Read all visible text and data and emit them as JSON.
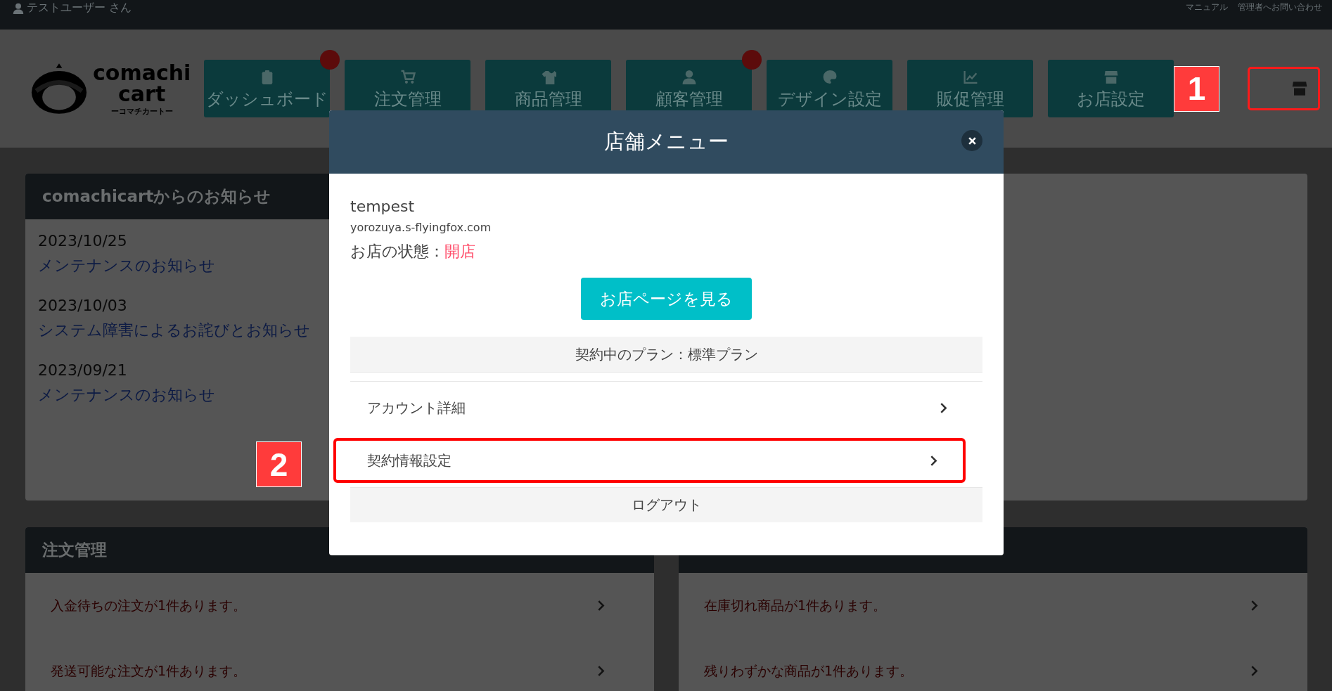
{
  "top_bar": {
    "user": "テストユーザー さん",
    "links": [
      "マニュアル",
      "管理者へお問い合わせ"
    ]
  },
  "logo": {
    "line1": "comachi",
    "line2": "cart",
    "tagline": "ーコマチカートー"
  },
  "nav": [
    {
      "label": "ダッシュボード",
      "badge": true
    },
    {
      "label": "注文管理",
      "badge": false
    },
    {
      "label": "商品管理",
      "badge": false
    },
    {
      "label": "顧客管理",
      "badge": true
    },
    {
      "label": "デザイン設定",
      "badge": false
    },
    {
      "label": "販促管理",
      "badge": false
    },
    {
      "label": "お店設定",
      "badge": false
    }
  ],
  "header_annotation": "1",
  "store_button": {
    "highlighted": true
  },
  "notices": {
    "title": "comachicartからのお知らせ",
    "items": [
      {
        "date": "2023/10/25",
        "title": "メンテナンスのお知らせ"
      },
      {
        "date": "2023/10/03",
        "title": "システム障害によるお詫びとお知らせ"
      },
      {
        "date": "2023/09/21",
        "title": "メンテナンスのお知らせ"
      }
    ]
  },
  "orders_panel": {
    "title": "注文管理",
    "items": [
      "入金待ちの注文が1件あります。",
      "発送可能な注文が1件あります。"
    ]
  },
  "stock_panel": {
    "items": [
      "在庫切れ商品が1件あります。",
      "残りわずかな商品が1件あります。"
    ]
  },
  "modal_annotation": "2",
  "modal": {
    "title": "店舗メニュー",
    "shop_name": "tempest",
    "domain": "yorozuya.s-flyingfox.com",
    "status_label": "お店の状態：",
    "status": "開店",
    "view_button": "お店ページを見る",
    "plan": "契約中のプラン：標準プラン",
    "menu": [
      {
        "label": "アカウント詳細",
        "highlighted": false
      },
      {
        "label": "契約情報設定",
        "highlighted": true
      }
    ],
    "logout": "ログアウト"
  }
}
